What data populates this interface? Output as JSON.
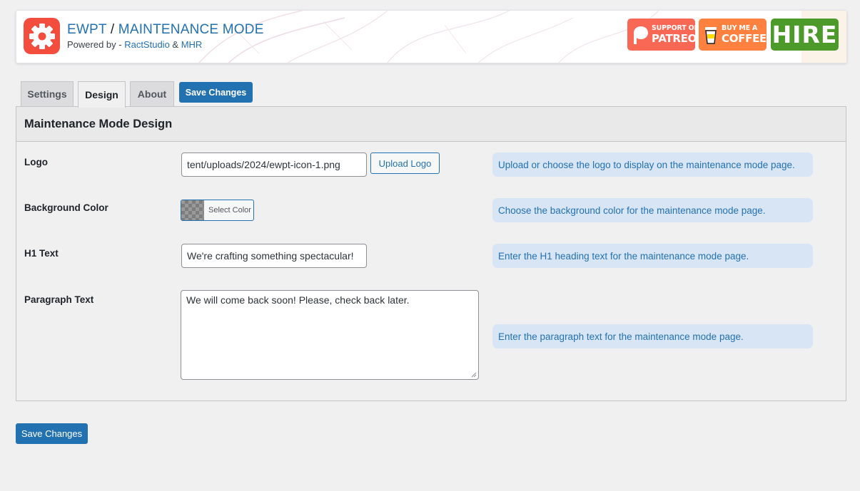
{
  "header": {
    "app_name": "EWPT",
    "separator": "/",
    "page_name": "MAINTENANCE MODE",
    "powered_prefix": "Powered by - ",
    "author1": "RactStudio",
    "amp": "&",
    "author2": "MHR",
    "badges": {
      "patreon_small": "SUPPORT ON",
      "patreon_big": "PATREON",
      "coffee_small": "BUY ME A",
      "coffee_big": "COFFEE",
      "hire": "HIRE"
    }
  },
  "tabs": [
    {
      "label": "Settings",
      "active": false
    },
    {
      "label": "Design",
      "active": true
    },
    {
      "label": "About",
      "active": false
    }
  ],
  "save_label": "Save Changes",
  "panel": {
    "title": "Maintenance Mode Design",
    "fields": {
      "logo": {
        "label": "Logo",
        "value": "tent/uploads/2024/ewpt-icon-1.png",
        "button": "Upload Logo",
        "help": "Upload or choose the logo to display on the maintenance mode page."
      },
      "background": {
        "label": "Background Color",
        "button": "Select Color",
        "help": "Choose the background color for the maintenance mode page."
      },
      "h1": {
        "label": "H1 Text",
        "value": "We're crafting something spectacular!",
        "help": "Enter the H1 heading text for the maintenance mode page."
      },
      "paragraph": {
        "label": "Paragraph Text",
        "value": "We will come back soon! Please, check back later.",
        "help": "Enter the paragraph text for the maintenance mode page."
      }
    }
  },
  "colors": {
    "primary": "#2271b1",
    "logo_bg": "#f24d3d",
    "patreon": "#f96854",
    "coffee": "#ff813f",
    "hire": "#4c9a2a",
    "help_bg": "#d8e5f5"
  }
}
